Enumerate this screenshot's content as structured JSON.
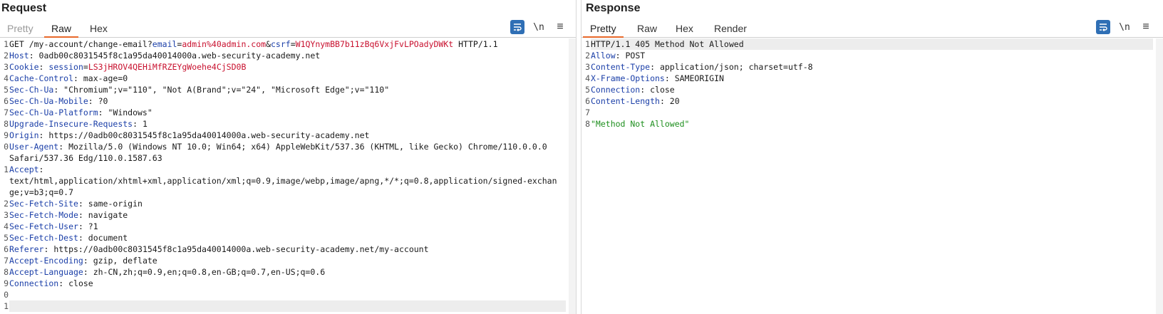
{
  "request": {
    "title": "Request",
    "tabs": [
      "Pretty",
      "Raw",
      "Hex"
    ],
    "active_tab": "Raw",
    "toolbar": {
      "newline_label": "\\n",
      "menu_label": "≡"
    },
    "lines": [
      {
        "n": "1",
        "parts": [
          {
            "t": "GET /my-account/change-email?",
            "c": "plain"
          },
          {
            "t": "email",
            "c": "pk"
          },
          {
            "t": "=",
            "c": "plain"
          },
          {
            "t": "admin%40admin.com",
            "c": "pv"
          },
          {
            "t": "&",
            "c": "plain"
          },
          {
            "t": "csrf",
            "c": "pk"
          },
          {
            "t": "=",
            "c": "plain"
          },
          {
            "t": "W1QYnymBB7b11zBq6VxjFvLPOadyDWKt",
            "c": "pv"
          },
          {
            "t": " HTTP/1.1",
            "c": "plain"
          }
        ]
      },
      {
        "n": "2",
        "parts": [
          {
            "t": "Host",
            "c": "hk"
          },
          {
            "t": ": 0adb00c8031545f8c1a95da40014000a.web-security-academy.net",
            "c": "plain"
          }
        ]
      },
      {
        "n": "3",
        "parts": [
          {
            "t": "Cookie",
            "c": "hk"
          },
          {
            "t": ": ",
            "c": "plain"
          },
          {
            "t": "session",
            "c": "pk"
          },
          {
            "t": "=",
            "c": "plain"
          },
          {
            "t": "LS3jHROV4QEHiMfRZEYgWoehe4CjSD0B",
            "c": "pv"
          }
        ]
      },
      {
        "n": "4",
        "parts": [
          {
            "t": "Cache-Control",
            "c": "hk"
          },
          {
            "t": ": max-age=0",
            "c": "plain"
          }
        ]
      },
      {
        "n": "5",
        "parts": [
          {
            "t": "Sec-Ch-Ua",
            "c": "hk"
          },
          {
            "t": ": \"Chromium\";v=\"110\", \"Not A(Brand\";v=\"24\", \"Microsoft Edge\";v=\"110\"",
            "c": "plain"
          }
        ]
      },
      {
        "n": "6",
        "parts": [
          {
            "t": "Sec-Ch-Ua-Mobile",
            "c": "hk"
          },
          {
            "t": ": ?0",
            "c": "plain"
          }
        ]
      },
      {
        "n": "7",
        "parts": [
          {
            "t": "Sec-Ch-Ua-Platform",
            "c": "hk"
          },
          {
            "t": ": \"Windows\"",
            "c": "plain"
          }
        ]
      },
      {
        "n": "8",
        "parts": [
          {
            "t": "Upgrade-Insecure-Requests",
            "c": "hk"
          },
          {
            "t": ": 1",
            "c": "plain"
          }
        ]
      },
      {
        "n": "9",
        "parts": [
          {
            "t": "Origin",
            "c": "hk"
          },
          {
            "t": ": https://0adb00c8031545f8c1a95da40014000a.web-security-academy.net",
            "c": "plain"
          }
        ]
      },
      {
        "n": "0",
        "parts": [
          {
            "t": "User-Agent",
            "c": "hk"
          },
          {
            "t": ": Mozilla/5.0 (Windows NT 10.0; Win64; x64) AppleWebKit/537.36 (KHTML, like Gecko) Chrome/110.0.0.0",
            "c": "plain"
          }
        ]
      },
      {
        "n": "",
        "parts": [
          {
            "t": "Safari/537.36 Edg/110.0.1587.63",
            "c": "plain"
          }
        ]
      },
      {
        "n": "1",
        "parts": [
          {
            "t": "Accept",
            "c": "hk"
          },
          {
            "t": ":",
            "c": "plain"
          }
        ]
      },
      {
        "n": "",
        "parts": [
          {
            "t": "text/html,application/xhtml+xml,application/xml;q=0.9,image/webp,image/apng,*/*;q=0.8,application/signed-exchan",
            "c": "plain"
          }
        ]
      },
      {
        "n": "",
        "parts": [
          {
            "t": "ge;v=b3;q=0.7",
            "c": "plain"
          }
        ]
      },
      {
        "n": "2",
        "parts": [
          {
            "t": "Sec-Fetch-Site",
            "c": "hk"
          },
          {
            "t": ": same-origin",
            "c": "plain"
          }
        ]
      },
      {
        "n": "3",
        "parts": [
          {
            "t": "Sec-Fetch-Mode",
            "c": "hk"
          },
          {
            "t": ": navigate",
            "c": "plain"
          }
        ]
      },
      {
        "n": "4",
        "parts": [
          {
            "t": "Sec-Fetch-User",
            "c": "hk"
          },
          {
            "t": ": ?1",
            "c": "plain"
          }
        ]
      },
      {
        "n": "5",
        "parts": [
          {
            "t": "Sec-Fetch-Dest",
            "c": "hk"
          },
          {
            "t": ": document",
            "c": "plain"
          }
        ]
      },
      {
        "n": "6",
        "parts": [
          {
            "t": "Referer",
            "c": "hk"
          },
          {
            "t": ": https://0adb00c8031545f8c1a95da40014000a.web-security-academy.net/my-account",
            "c": "plain"
          }
        ]
      },
      {
        "n": "7",
        "parts": [
          {
            "t": "Accept-Encoding",
            "c": "hk"
          },
          {
            "t": ": gzip, deflate",
            "c": "plain"
          }
        ]
      },
      {
        "n": "8",
        "parts": [
          {
            "t": "Accept-Language",
            "c": "hk"
          },
          {
            "t": ": zh-CN,zh;q=0.9,en;q=0.8,en-GB;q=0.7,en-US;q=0.6",
            "c": "plain"
          }
        ]
      },
      {
        "n": "9",
        "parts": [
          {
            "t": "Connection",
            "c": "hk"
          },
          {
            "t": ": close",
            "c": "plain"
          }
        ]
      },
      {
        "n": "0",
        "parts": []
      },
      {
        "n": "1",
        "parts": [],
        "highlight": true
      }
    ]
  },
  "response": {
    "title": "Response",
    "tabs": [
      "Pretty",
      "Raw",
      "Hex",
      "Render"
    ],
    "active_tab": "Pretty",
    "toolbar": {
      "newline_label": "\\n",
      "menu_label": "≡"
    },
    "lines": [
      {
        "n": "1",
        "parts": [
          {
            "t": "HTTP/1.1 405 Method Not Allowed",
            "c": "plain"
          }
        ],
        "highlight": true
      },
      {
        "n": "2",
        "parts": [
          {
            "t": "Allow",
            "c": "hk"
          },
          {
            "t": ": POST",
            "c": "plain"
          }
        ]
      },
      {
        "n": "3",
        "parts": [
          {
            "t": "Content-Type",
            "c": "hk"
          },
          {
            "t": ": application/json; charset=utf-8",
            "c": "plain"
          }
        ]
      },
      {
        "n": "4",
        "parts": [
          {
            "t": "X-Frame-Options",
            "c": "hk"
          },
          {
            "t": ": SAMEORIGIN",
            "c": "plain"
          }
        ]
      },
      {
        "n": "5",
        "parts": [
          {
            "t": "Connection",
            "c": "hk"
          },
          {
            "t": ": close",
            "c": "plain"
          }
        ]
      },
      {
        "n": "6",
        "parts": [
          {
            "t": "Content-Length",
            "c": "hk"
          },
          {
            "t": ": 20",
            "c": "plain"
          }
        ]
      },
      {
        "n": "7",
        "parts": []
      },
      {
        "n": "8",
        "parts": [
          {
            "t": "\"Method Not Allowed\"",
            "c": "js"
          }
        ]
      }
    ]
  },
  "colors": {
    "accent": "#2f6fb5",
    "tab_underline": "#e8682a",
    "header_key": "#1b3fa8",
    "param_value": "#c8102e",
    "json_string": "#1e8f1e"
  }
}
